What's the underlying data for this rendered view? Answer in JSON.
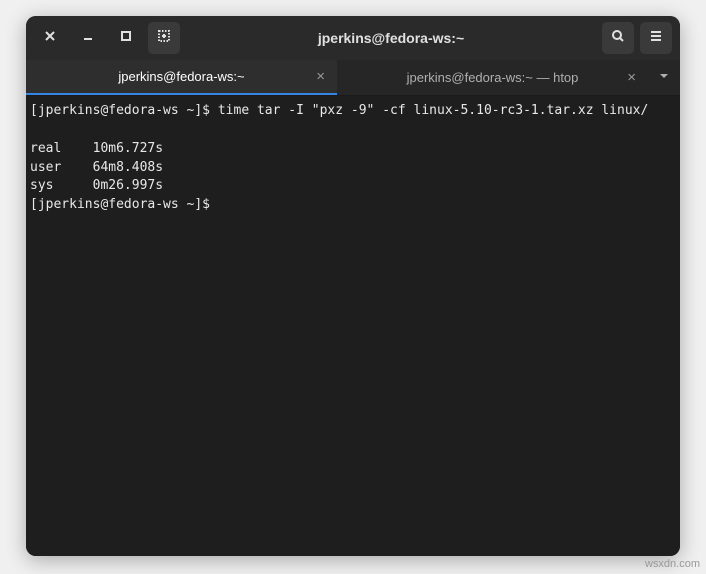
{
  "titlebar": {
    "title": "jperkins@fedora-ws:~"
  },
  "tabs": [
    {
      "label": "jperkins@fedora-ws:~",
      "active": true
    },
    {
      "label": "jperkins@fedora-ws:~ — htop",
      "active": false
    }
  ],
  "terminal": {
    "prompt1": "[jperkins@fedora-ws ~]$ ",
    "command1": "time tar -I \"pxz -9\" -cf linux-5.10-rc3-1.tar.xz linux/",
    "blank1": "",
    "line_real": "real    10m6.727s",
    "line_user": "user    64m8.408s",
    "line_sys": "sys     0m26.997s",
    "prompt2": "[jperkins@fedora-ws ~]$ "
  },
  "watermark": "wsxdn.com"
}
